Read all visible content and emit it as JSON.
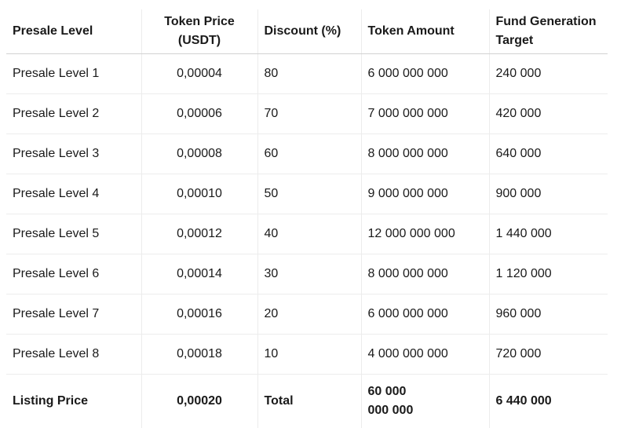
{
  "table": {
    "headers": [
      "Presale Level",
      "Token Price (USDT)",
      "Discount (%)",
      "Token Amount",
      "Fund Generation Target"
    ],
    "rows": [
      [
        "Presale Level 1",
        "0,00004",
        "80",
        "6 000 000 000",
        "240 000"
      ],
      [
        "Presale Level 2",
        "0,00006",
        "70",
        "7 000 000 000",
        "420 000"
      ],
      [
        "Presale Level 3",
        "0,00008",
        "60",
        "8 000 000 000",
        "640 000"
      ],
      [
        "Presale Level 4",
        "0,00010",
        "50",
        "9 000 000 000",
        "900 000"
      ],
      [
        "Presale Level 5",
        "0,00012",
        "40",
        "12 000 000 000",
        "1 440 000"
      ],
      [
        "Presale Level 6",
        "0,00014",
        "30",
        "8 000 000 000",
        "1 120 000"
      ],
      [
        "Presale Level 7",
        "0,00016",
        "20",
        "6 000 000 000",
        "960 000"
      ],
      [
        "Presale Level 8",
        "0,00018",
        "10",
        "4 000 000 000",
        "720 000"
      ]
    ],
    "footer": [
      "Listing Price",
      "0,00020",
      "Total",
      "60 000 000 000",
      "6 440 000"
    ]
  }
}
